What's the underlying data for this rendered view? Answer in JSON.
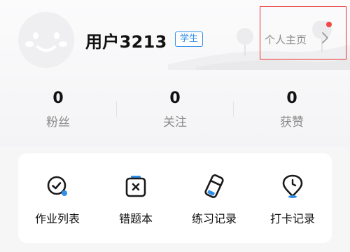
{
  "profile": {
    "username": "用户3213",
    "role_badge": "学生",
    "homepage_link": "个人主页"
  },
  "stats": [
    {
      "value": "0",
      "label": "粉丝"
    },
    {
      "value": "0",
      "label": "关注"
    },
    {
      "value": "0",
      "label": "获赞"
    }
  ],
  "tools": [
    {
      "label": "作业列表",
      "icon": "homework-check-icon"
    },
    {
      "label": "错题本",
      "icon": "wrong-questions-icon"
    },
    {
      "label": "练习记录",
      "icon": "practice-eraser-icon"
    },
    {
      "label": "打卡记录",
      "icon": "checkin-location-clock-icon"
    }
  ],
  "colors": {
    "accent_blue": "#2f8fe8",
    "highlight_red": "#e62e2e",
    "notification_dot": "#f04848"
  }
}
